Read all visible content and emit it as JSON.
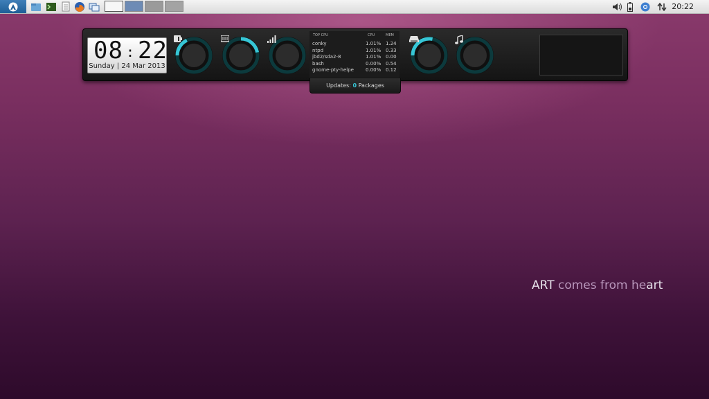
{
  "panel": {
    "menu_icon": "menu-logo-icon",
    "launchers": [
      "file-manager-icon",
      "terminal-icon",
      "text-editor-icon",
      "firefox-icon",
      "window-switcher-icon"
    ],
    "workspaces": 4,
    "active_workspace": 1,
    "tray_icons": [
      "volume-icon",
      "battery-icon",
      "chromium-icon",
      "network-icon"
    ],
    "clock": "20:22"
  },
  "conky": {
    "time_hour": "08",
    "time_minute": "22",
    "date": "Sunday | 24 Mar 2013",
    "gauges": [
      {
        "name": "battery-gauge",
        "icon": "battery-icon",
        "level": 0.18
      },
      {
        "name": "memory-gauge",
        "icon": "memory-icon",
        "level": 0.22
      },
      {
        "name": "signal-gauge",
        "icon": "signal-icon",
        "level": 0.0
      },
      {
        "name": "disk-gauge",
        "icon": "disk-icon",
        "level": 0.28
      },
      {
        "name": "music-gauge",
        "icon": "music-icon",
        "level": 0.0
      }
    ],
    "top_cpu": {
      "header_process": "TOP CPU",
      "header_cpu": "CPU",
      "header_mem": "MEM",
      "rows": [
        {
          "process": "conky",
          "cpu": "1.01%",
          "mem": "1.24"
        },
        {
          "process": "ntpd",
          "cpu": "1.01%",
          "mem": "0.33"
        },
        {
          "process": "jbd2/sda2-8",
          "cpu": "1.01%",
          "mem": "0.00"
        },
        {
          "process": "bash",
          "cpu": "0.00%",
          "mem": "0.54"
        },
        {
          "process": "gnome-pty-helpe",
          "cpu": "0.00%",
          "mem": "0.12"
        }
      ]
    },
    "updates_label": "Updates:",
    "updates_count": "0",
    "updates_unit": "Packages"
  },
  "desktop": {
    "slogan_part1": "ART",
    "slogan_part2": " comes from he",
    "slogan_part3": "art"
  },
  "colors": {
    "accent": "#36c6d6",
    "panel": "#e6e6e6",
    "wallpaper": "#6b2858"
  }
}
